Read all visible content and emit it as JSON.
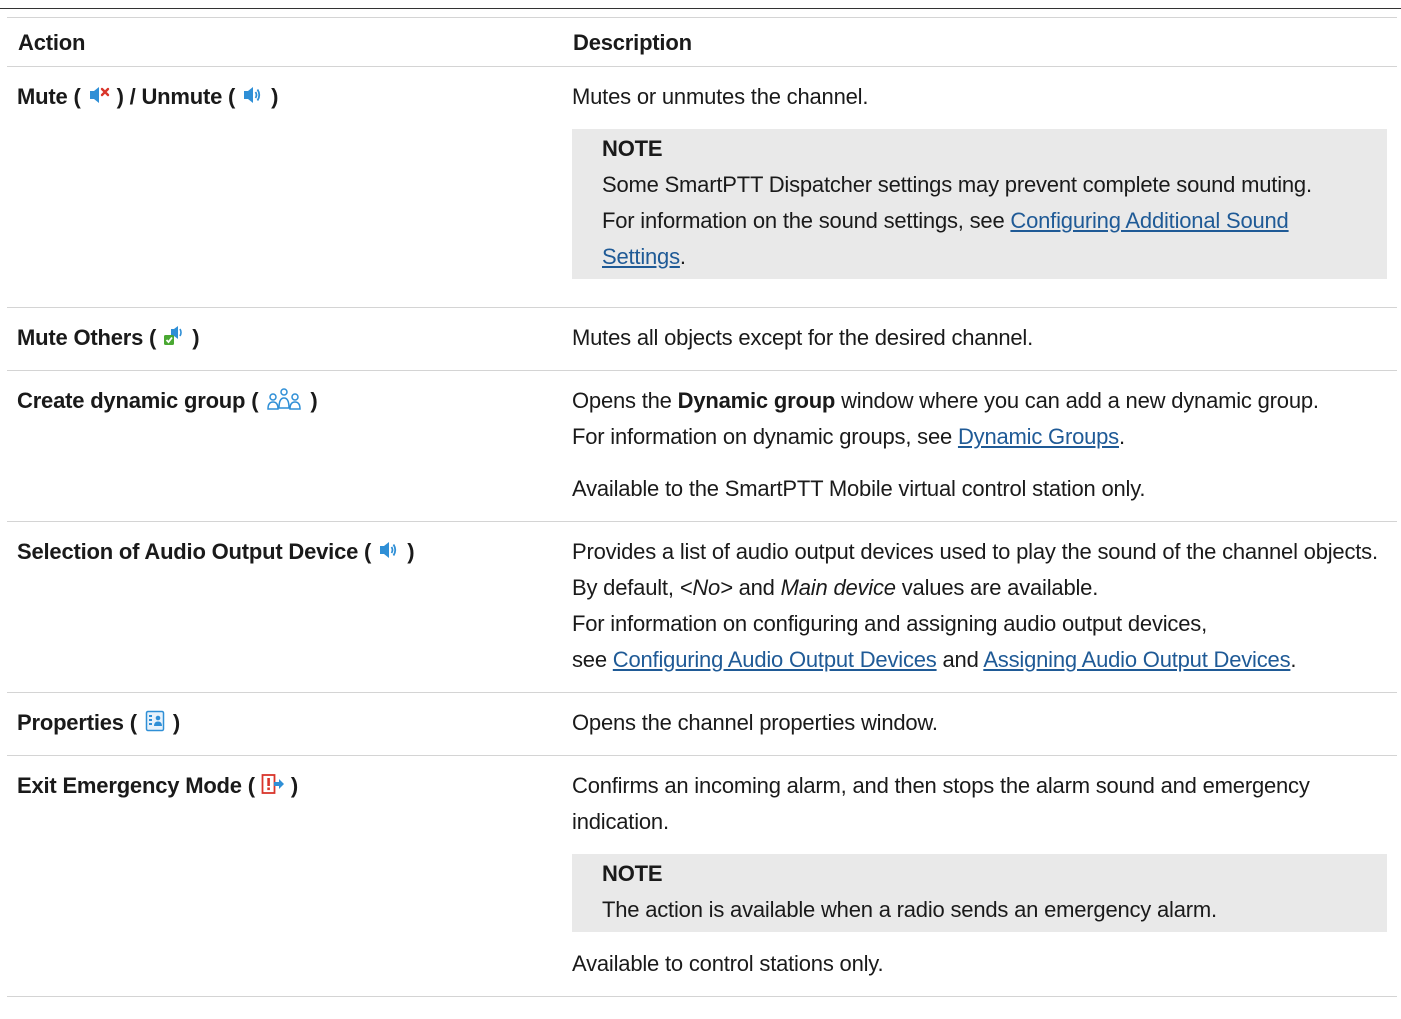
{
  "table": {
    "headers": [
      "Action",
      "Description"
    ],
    "rows": [
      {
        "action": {
          "pre": "Mute (",
          "mid": ") / Unmute (",
          "post": ")"
        },
        "desc_1": "Mutes or unmutes the channel.",
        "note": {
          "title": "NOTE",
          "text_1": "Some SmartPTT Dispatcher settings may prevent complete sound muting.",
          "text_2": "For information on the sound settings, see ",
          "link": "Configuring Additional Sound Settings",
          "text_3": "."
        }
      },
      {
        "action": {
          "pre": "Mute Others (",
          "post": ")"
        },
        "desc_1": "Mutes all objects except for the desired channel."
      },
      {
        "action": {
          "pre": "Create dynamic group (",
          "post": ")"
        },
        "desc_pre": "Opens the ",
        "desc_bold": "Dynamic group",
        "desc_post": " window where you can add a new dynamic group.",
        "desc_2_pre": "For information on dynamic groups, see ",
        "desc_2_link": "Dynamic Groups",
        "desc_2_post": ".",
        "desc_3": "Available to the SmartPTT Mobile virtual control station only."
      },
      {
        "action": {
          "pre": "Selection of Audio Output Device (",
          "post": ")"
        },
        "desc_a": "Provides a list of audio output devices used to play the sound of the channel objects. By default, ",
        "desc_em1": "<No>",
        "desc_b": " and ",
        "desc_em2": "Main device",
        "desc_c": " values are available.",
        "desc_d": "For information on configuring and assigning audio output devices,",
        "desc_e": "see ",
        "link_1": "Configuring Audio Output Devices",
        "desc_f": " and ",
        "link_2": "Assigning Audio Output Devices",
        "desc_g": "."
      },
      {
        "action": {
          "pre": "Properties (",
          "post": ")"
        },
        "desc_1": "Opens the channel properties window."
      },
      {
        "action": {
          "pre": "Exit Emergency Mode (",
          "post": ")"
        },
        "desc_1": "Confirms an incoming alarm, and then stops the alarm sound and emergency indication.",
        "note": {
          "title": "NOTE",
          "text_1": "The action is available when a radio sends an emergency alarm."
        },
        "desc_2": "Available to control stations only."
      }
    ]
  },
  "icons": {
    "mute": "speaker-muted-icon",
    "unmute": "speaker-icon",
    "mute_others": "mute-others-icon",
    "dynamic_group": "dynamic-group-icon",
    "audio_output": "audio-output-icon",
    "properties": "properties-icon",
    "exit_emergency": "exit-emergency-icon"
  },
  "colors": {
    "link": "#1f5a96",
    "note_bg": "#e9e9e9",
    "icon_blue": "#2f8fd6",
    "alarm_red": "#d9352b",
    "check_green": "#4aa832"
  }
}
